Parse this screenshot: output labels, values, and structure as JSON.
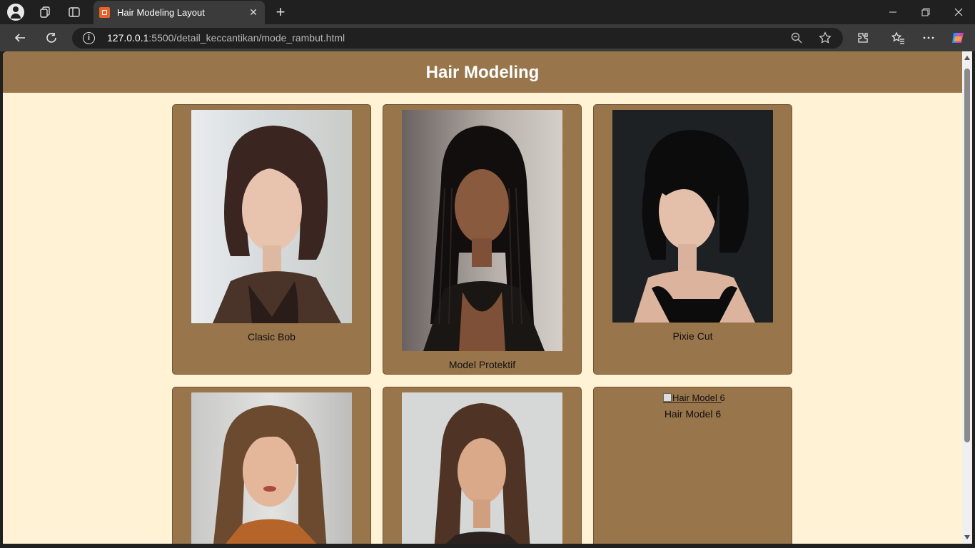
{
  "browser": {
    "tab_title": "Hair Modeling Layout",
    "url_host": "127.0.0.1",
    "url_path": ":5500/detail_keccantikan/mode_rambut.html",
    "icons": [
      "profile-icon",
      "workspaces-icon",
      "tab-actions-icon",
      "close-icon",
      "plus-icon",
      "back-icon",
      "reload-icon",
      "info-icon",
      "zoom-out-icon",
      "star-icon",
      "extensions-icon",
      "favorites-icon",
      "more-icon",
      "copilot-icon"
    ]
  },
  "page": {
    "title": "Hair Modeling",
    "cards": [
      {
        "caption": "Clasic Bob",
        "image": "photo",
        "hair_color": "#3a2520"
      },
      {
        "caption": "Model Protektif",
        "image": "photo",
        "hair_color": "#120e0d"
      },
      {
        "caption": "Pixie Cut",
        "image": "photo",
        "hair_color": "#0d0c0c"
      },
      {
        "caption": "",
        "image": "photo",
        "hair_color": "#6b4a30"
      },
      {
        "caption": "",
        "image": "photo",
        "hair_color": "#4f3425"
      },
      {
        "caption": "Hair Model 6",
        "image": "broken",
        "alt": "Hair Model 6"
      }
    ]
  },
  "colors": {
    "header": "#98754b",
    "page_background": "#fff2d5",
    "card": "#98754b"
  }
}
